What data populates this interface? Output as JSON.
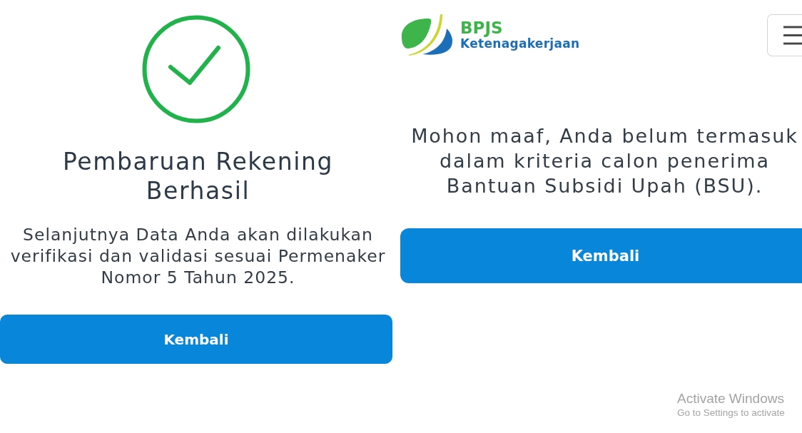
{
  "success_panel": {
    "title_lines": [
      "Pembaruan Rekening",
      "Berhasil"
    ],
    "message_lines": [
      "Selanjutnya Data Anda akan dilakukan",
      "verifikasi dan validasi sesuai Permenaker",
      "Nomor 5 Tahun 2025."
    ],
    "button": "Kembali"
  },
  "result_panel": {
    "header": {
      "logo_title": "BPJS",
      "logo_subtitle": "Ketenagakerjaan"
    },
    "message_lines": [
      "Mohon maaf, Anda belum termasuk",
      "dalam kriteria calon penerima",
      "Bantuan Subsidi Upah (BSU)."
    ],
    "button": "Kembali"
  },
  "os_notice": {
    "title": "Activate Windows",
    "subtitle": "Go to Settings to activate"
  }
}
